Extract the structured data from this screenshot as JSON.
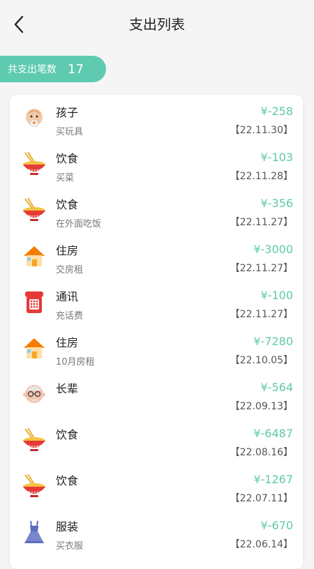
{
  "header": {
    "title": "支出列表",
    "back_icon": "chevron-left-icon"
  },
  "summary": {
    "label": "共支出笔数",
    "count": "17"
  },
  "colors": {
    "accent": "#5ecbb0",
    "amount": "#5ec9a8"
  },
  "items": [
    {
      "category": "孩子",
      "note": "买玩具",
      "amount": "¥-258",
      "date": "【22.11.30】",
      "icon": "baby-icon"
    },
    {
      "category": "饮食",
      "note": "买菜",
      "amount": "¥-103",
      "date": "【22.11.28】",
      "icon": "noodle-bowl-icon"
    },
    {
      "category": "饮食",
      "note": "在外面吃饭",
      "amount": "¥-356",
      "date": "【22.11.27】",
      "icon": "noodle-bowl-icon"
    },
    {
      "category": "住房",
      "note": "交房租",
      "amount": "¥-3000",
      "date": "【22.11.27】",
      "icon": "house-icon"
    },
    {
      "category": "通讯",
      "note": "充话费",
      "amount": "¥-100",
      "date": "【22.11.27】",
      "icon": "telephone-icon"
    },
    {
      "category": "住房",
      "note": "10月房租",
      "amount": "¥-7280",
      "date": "【22.10.05】",
      "icon": "house-icon"
    },
    {
      "category": "长辈",
      "note": "",
      "amount": "¥-564",
      "date": "【22.09.13】",
      "icon": "grandpa-icon"
    },
    {
      "category": "饮食",
      "note": "",
      "amount": "¥-6487",
      "date": "【22.08.16】",
      "icon": "noodle-bowl-icon"
    },
    {
      "category": "饮食",
      "note": "",
      "amount": "¥-1267",
      "date": "【22.07.11】",
      "icon": "noodle-bowl-icon"
    },
    {
      "category": "服装",
      "note": "买衣服",
      "amount": "¥-670",
      "date": "【22.06.14】",
      "icon": "dress-icon"
    }
  ]
}
